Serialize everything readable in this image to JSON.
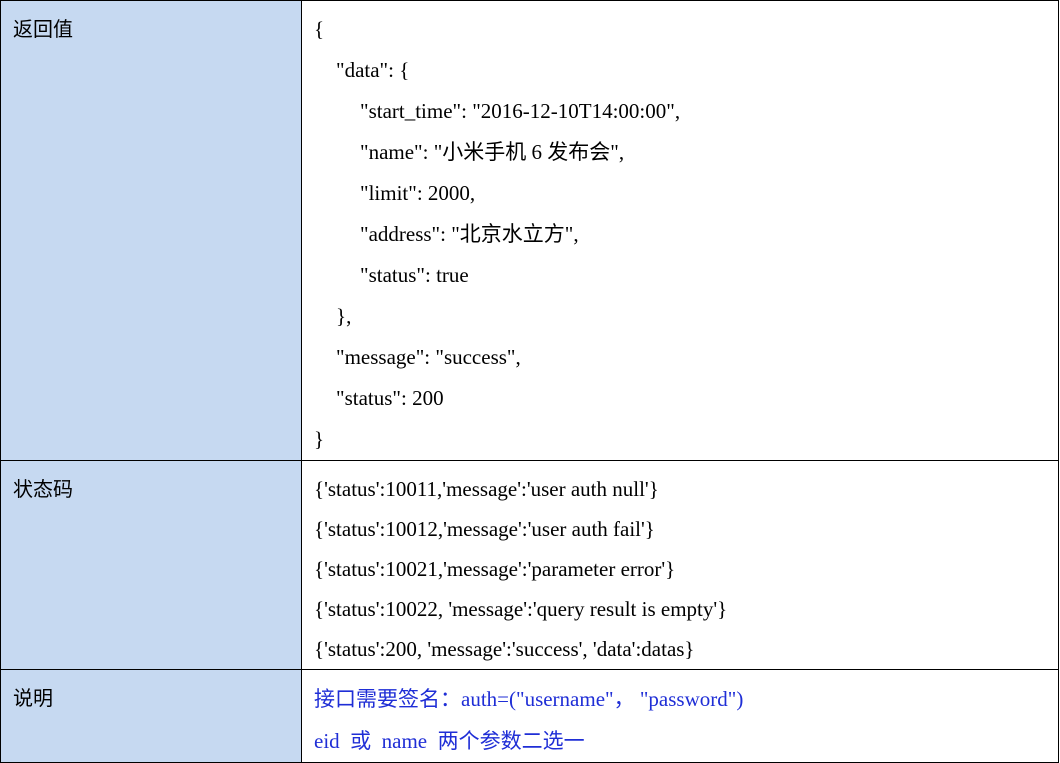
{
  "rows": {
    "return_value": {
      "label": "返回值",
      "lines": [
        "{",
        "\"data\": {",
        "\"start_time\": \"2016-12-10T14:00:00\",",
        "\"name\": \"小米手机 6 发布会\",",
        "\"limit\": 2000,",
        "\"address\": \"北京水立方\",",
        "\"status\": true",
        "},",
        "\"message\": \"success\",",
        "\"status\": 200",
        "}"
      ]
    },
    "status_code": {
      "label": "状态码",
      "lines": [
        "{'status':10011,'message':'user auth null'}",
        "{'status':10012,'message':'user auth fail'}",
        "{'status':10021,'message':'parameter error'}",
        "{'status':10022, 'message':'query result is empty'}",
        "{'status':200, 'message':'success', 'data':datas}"
      ]
    },
    "description": {
      "label": "说明",
      "lines": [
        "接口需要签名：auth=(\"username\"， \"password\")",
        "eid  或  name  两个参数二选一"
      ]
    }
  },
  "colors": {
    "label_background": "#c6d9f1",
    "note_text": "#1f2ed6",
    "border": "#000000"
  }
}
